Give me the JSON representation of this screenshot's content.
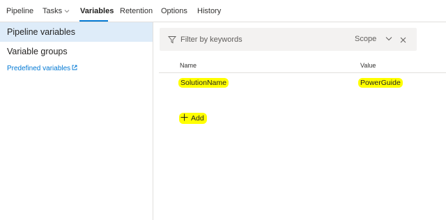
{
  "tabs": [
    {
      "label": "Pipeline"
    },
    {
      "label": "Tasks"
    },
    {
      "label": "Variables"
    },
    {
      "label": "Retention"
    },
    {
      "label": "Options"
    },
    {
      "label": "History"
    }
  ],
  "active_tab": "Variables",
  "sidebar": {
    "items": [
      {
        "label": "Pipeline variables",
        "selected": true
      },
      {
        "label": "Variable groups",
        "selected": false
      }
    ],
    "link_label": "Predefined variables"
  },
  "filter": {
    "placeholder": "Filter by keywords",
    "scope_label": "Scope"
  },
  "table": {
    "columns": [
      "Name",
      "Value"
    ],
    "rows": [
      {
        "name": "SolutionName",
        "value": "PowerGuide"
      }
    ]
  },
  "add_label": "Add",
  "colors": {
    "accent": "#0078d4",
    "selected_bg": "#deecf9",
    "highlight": "#ffff00"
  },
  "icons": [
    "chevron-down-icon",
    "external-link-icon",
    "filter-icon",
    "close-icon",
    "plus-icon"
  ]
}
